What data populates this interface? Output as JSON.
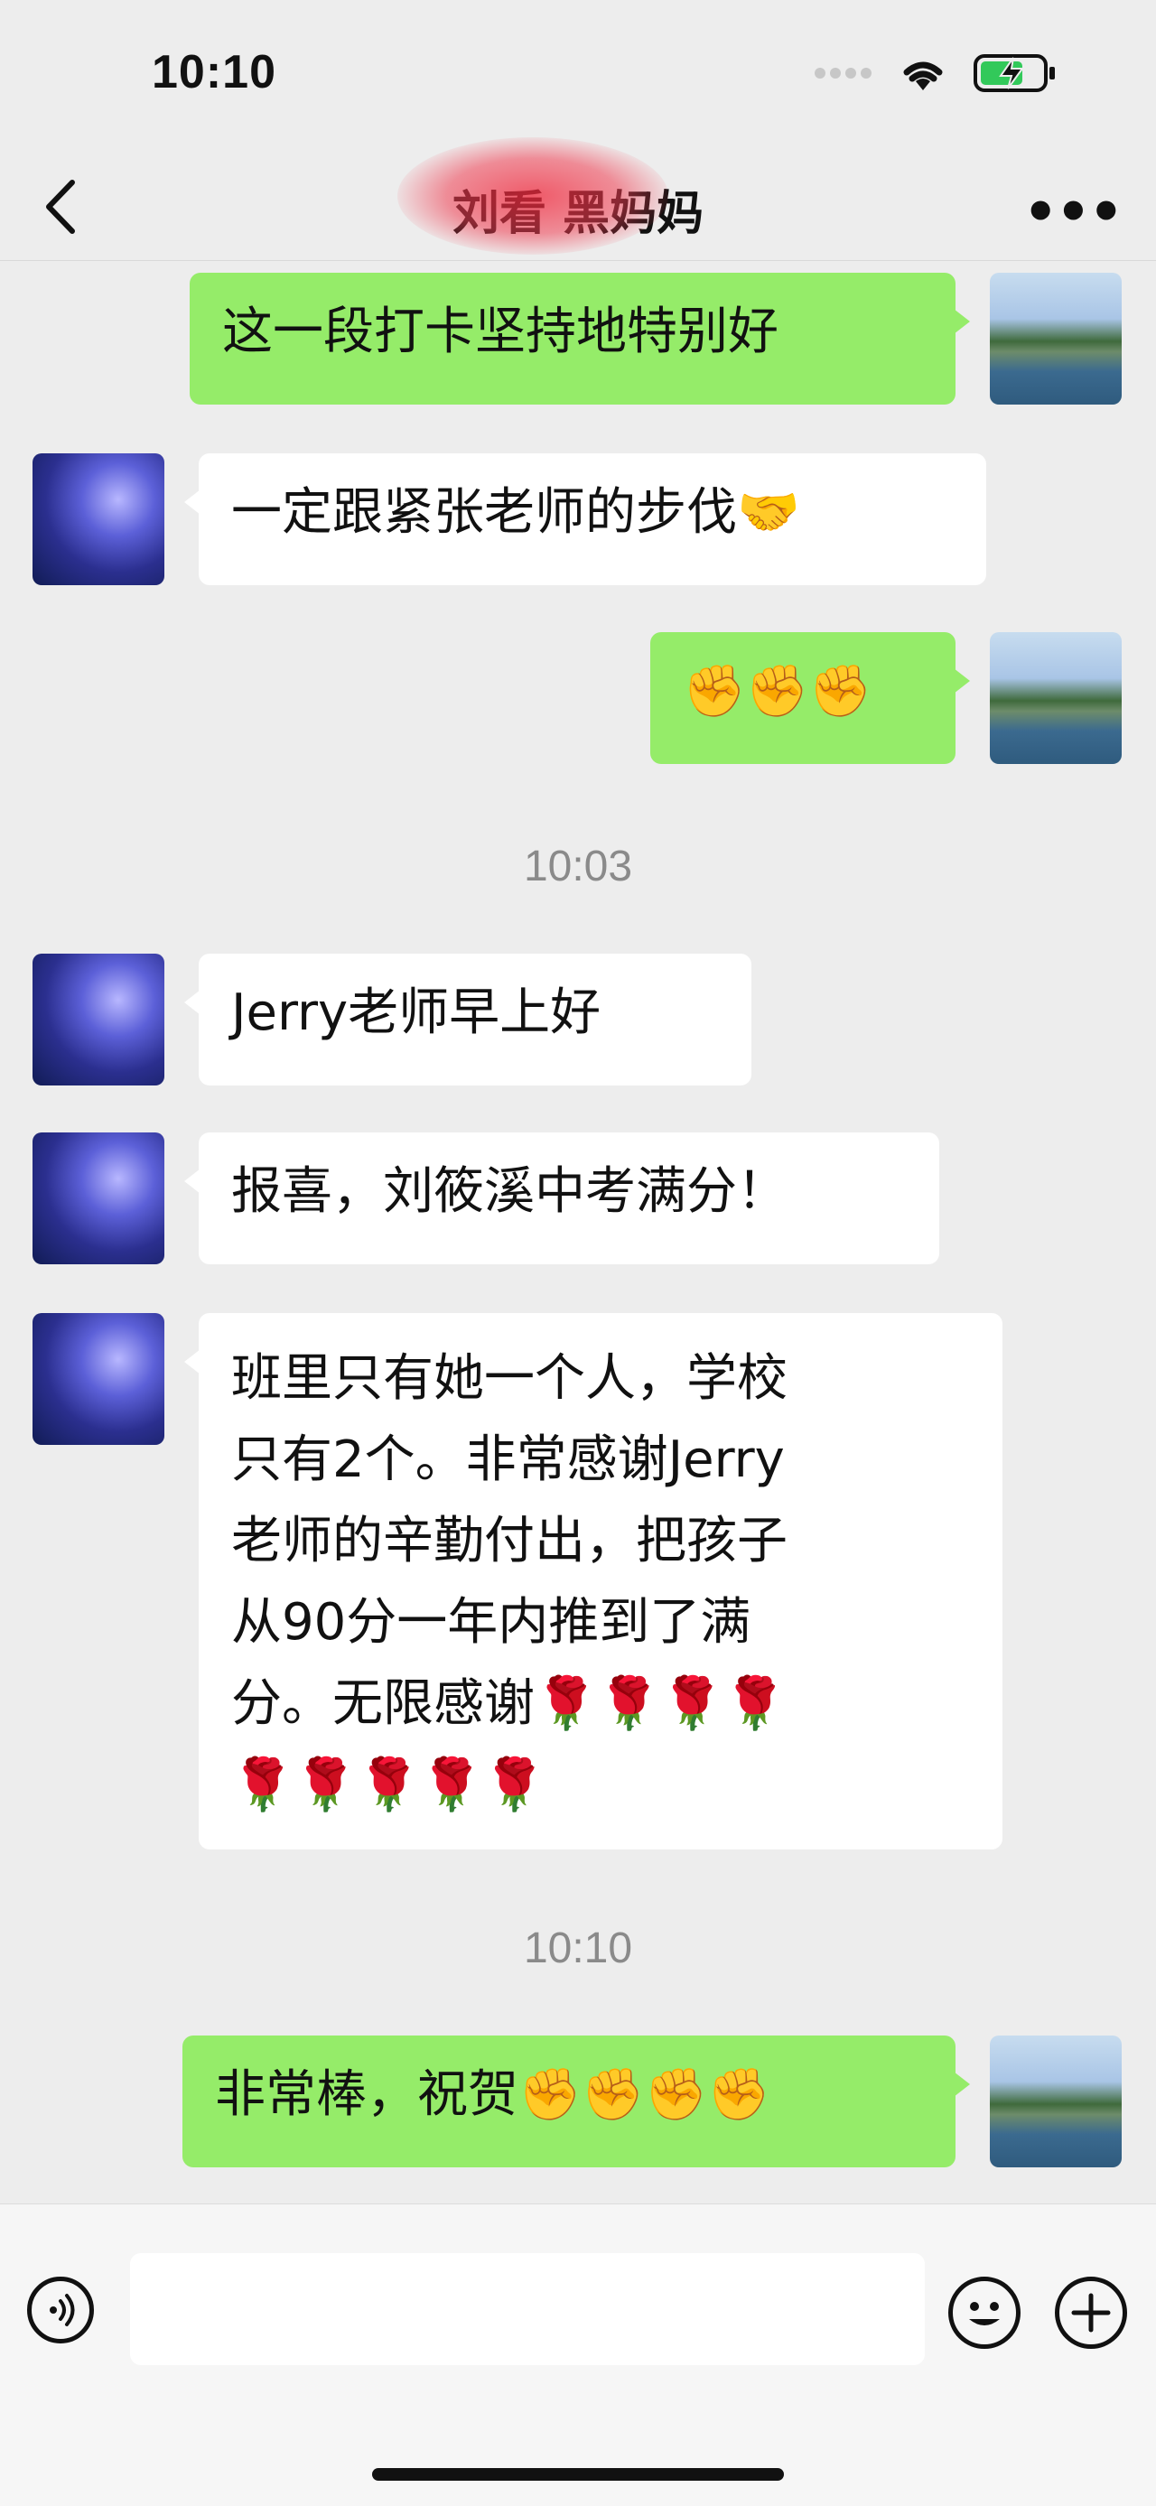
{
  "status_bar": {
    "time": "10:10",
    "icons": [
      "signal-icon",
      "wifi-icon",
      "battery-charging-icon"
    ]
  },
  "header": {
    "title": "刘看 黑妈妈",
    "back_icon": "chevron-left-icon",
    "more_icon": "more-dots-icon"
  },
  "messages": [
    {
      "side": "out",
      "text": "这一段打卡坚持地特别好"
    },
    {
      "side": "in",
      "text": "一定跟紧张老师的步伐🤝"
    },
    {
      "side": "out",
      "text": "✊✊✊"
    },
    {
      "type": "timestamp",
      "text": "10:03"
    },
    {
      "side": "in",
      "text": "Jerry老师早上好"
    },
    {
      "side": "in",
      "text": "报喜，刘筱溪中考满分！"
    },
    {
      "side": "in",
      "lines": [
        "班里只有她一个人，学校",
        "只有2个。非常感谢Jerry",
        "老师的辛勤付出，把孩子",
        "从90分一年内推到了满",
        "分。无限感谢🌹🌹🌹🌹",
        "🌹🌹🌹🌹🌹"
      ]
    },
    {
      "type": "timestamp",
      "text": "10:10"
    },
    {
      "side": "out",
      "text": "非常棒，祝贺✊✊✊✊"
    }
  ],
  "input_bar": {
    "voice_icon": "voice-icon",
    "emoji_icon": "smiley-icon",
    "plus_icon": "plus-icon"
  },
  "colors": {
    "outgoing_bubble": "#95ec69",
    "incoming_bubble": "#ffffff",
    "background": "#ededed"
  }
}
